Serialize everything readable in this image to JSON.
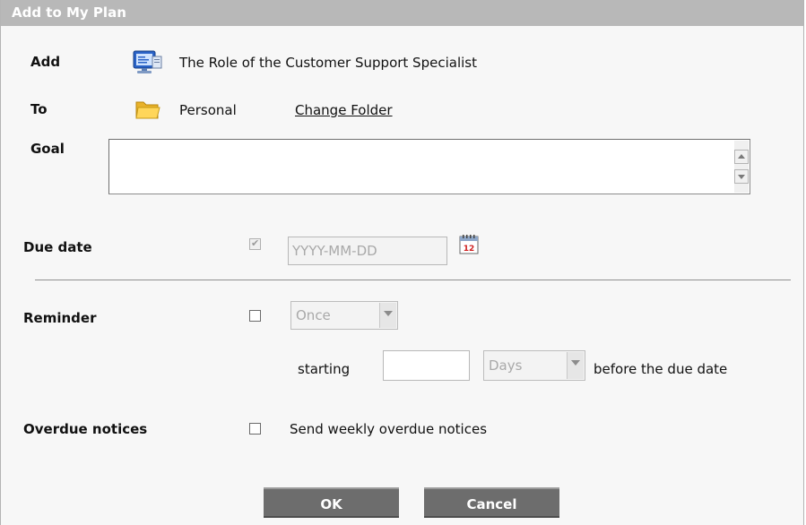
{
  "dialog": {
    "title": "Add to My Plan"
  },
  "add": {
    "label": "Add",
    "item": "The Role of the Customer Support Specialist"
  },
  "to": {
    "label": "To",
    "folder": "Personal",
    "change_link": "Change Folder"
  },
  "goal": {
    "label": "Goal",
    "value": ""
  },
  "due_date": {
    "label": "Due date",
    "checked": true,
    "placeholder": "YYYY-MM-DD",
    "calendar_day": "12"
  },
  "reminder": {
    "label": "Reminder",
    "frequency": "Once",
    "starting_label": "starting",
    "starting_value": "",
    "unit": "Days",
    "suffix": "before the due date"
  },
  "overdue": {
    "label": "Overdue notices",
    "option_text": "Send weekly overdue notices"
  },
  "buttons": {
    "ok": "OK",
    "cancel": "Cancel"
  },
  "colors": {
    "titlebar": "#b8b8b8",
    "button": "#6d6d6d",
    "background": "#f7f7f7"
  }
}
